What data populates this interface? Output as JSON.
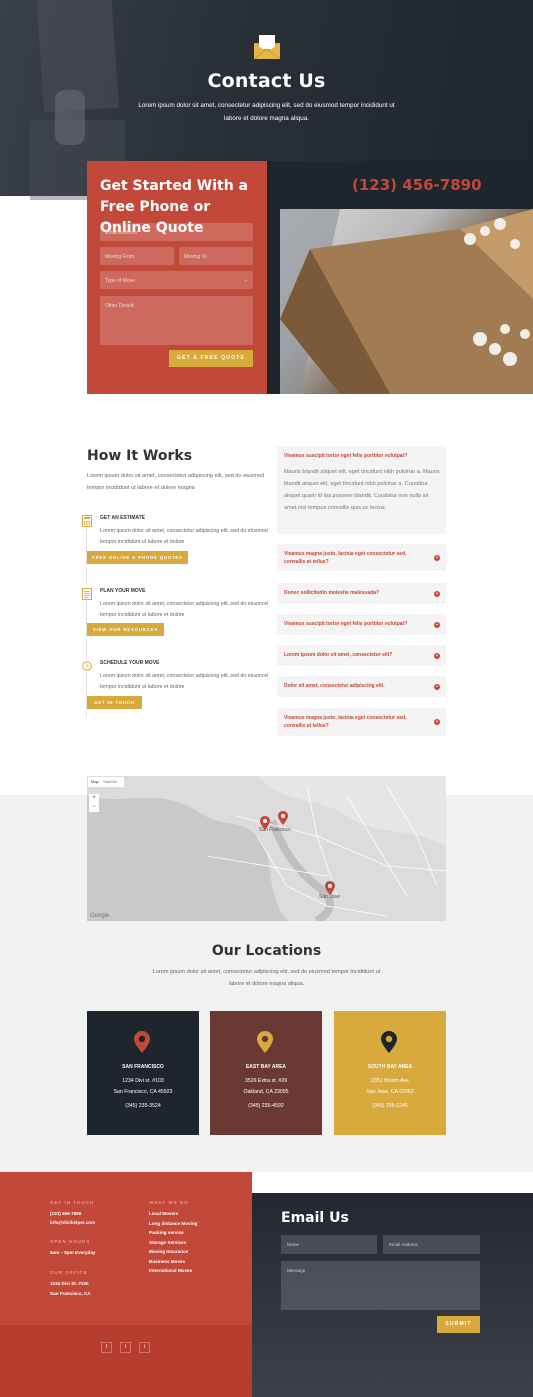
{
  "hero": {
    "title": "Contact Us",
    "text": "Lorem ipsum dolor sit amet, consectetur adipiscing elit, sed do eiusmod tempor incididunt ut labore et dolore magna aliqua."
  },
  "quote": {
    "title": "Get Started With a Free Phone or Online Quote",
    "email_placeholder": "Email Address",
    "moving_from_placeholder": "Moving From",
    "moving_to_placeholder": "Moving To",
    "type_of_move_placeholder": "Type of Move",
    "details_placeholder": "Other Details",
    "button": "GET A FREE QUOTE"
  },
  "phone": "(123) 456-7890",
  "how": {
    "title": "How It Works",
    "text": "Lorem ipsum dolor sit amet, consectetur adipiscing elit, sed do eiusmod tempor incididunt ut labore et dolore magna",
    "steps": [
      {
        "title": "GET AN ESTIMATE",
        "text": "Lorem ipsum dolor sit amet, consectetur adipiscing elit, sed do eiusmod tempor incididunt ut labore et dolore",
        "button": "FREE ONLINE & PHONE QUOTES",
        "icon": "calculator-icon"
      },
      {
        "title": "PLAN YOUR MOVE",
        "text": "Lorem ipsum dolor sit amet, consectetur adipiscing elit, sed do eiusmod tempor incididunt ut labore et dolore",
        "button": "VIEW OUR RESOURCES",
        "icon": "document-icon"
      },
      {
        "title": "SCHEDULE YOUR MOVE",
        "text": "Lorem ipsum dolor sit amet, consectetur adipiscing elit, sed do eiusmod tempor incididunt ut labore et dolore",
        "button": "GET IN TOUCH",
        "icon": "clock-icon"
      }
    ]
  },
  "faq": {
    "open_title": "Vivamus suscipit tortor eget felis porttitor volutpat?",
    "open_body": "Mauris blandit aliquet elit, eget tincidunt nibh pulvinar a. Mauris blandit aliquet elit, eget tincidunt nibh pulvinar a. Curabitur aliquet quam id dui posuere blandit. Curabitur non nulla sit amet nisl tempus convallis quis ac lectus.",
    "items": [
      "Vivamus magna justo, lacinia eget consectetur sed, convallis at tellus?",
      "Donec sollicitudin molestie malesuada?",
      "Vivamus suscipit tortor eget felis porttitor volutpat?",
      "Lorem ipsum dolor sit amet, consectetur elit?",
      "Dolor sit amet, consectetur adipiscing elit.",
      "Vivamus magna justo, lacinia eget consectetur sed, convallis at tellus?"
    ]
  },
  "map": {
    "tab_map": "Map",
    "tab_satellite": "Satellite",
    "zoom_in": "+",
    "zoom_out": "−",
    "label_sf": "San Francisco",
    "label_sj": "San Jose",
    "logo": "Google"
  },
  "locations": {
    "title": "Our Locations",
    "text": "Lorem ipsum dolor sit amet, consectetur adipiscing elit, sed do eiusmod tempor incididunt ut labore et dolore magna aliqua.",
    "cards": [
      {
        "city": "SAN FRANCISCO",
        "line1": "1234 Divi st. #103",
        "line2": "San Francisco, CA 45923",
        "phone": "(345) 235-3524",
        "color": "#1f252d",
        "pin": "#c2483a"
      },
      {
        "city": "EAST BAY AREA",
        "line1": "3526 Extra st. #29",
        "line2": "Oakland, CA 23095",
        "phone": "(345) 235-4592",
        "color": "#6b3933",
        "pin": "#d8a93c"
      },
      {
        "city": "SOUTH BAY AREA",
        "line1": "2351 Bloom Ave",
        "line2": "San Jose, CA 62962",
        "phone": "(345) 235-1245",
        "color": "#d8a93c",
        "pin": "#1f252d"
      }
    ]
  },
  "footer": {
    "touch_heading": "GET IN TOUCH",
    "touch_phone": "(123) 456-7890",
    "touch_email": "info@divihelper.com",
    "hours_heading": "OPEN HOURS",
    "hours": "6am – 5pm Everyday",
    "office_heading": "OUR OFFICE",
    "office_line1": "1234 Divi St. #100",
    "office_line2": "San Francisco, CA",
    "services_heading": "WHAT WE DO",
    "services": [
      "Local Movers",
      "Long distance Moving",
      "Packing service",
      "Storage Services",
      "Moving Insurance",
      "Business Moves",
      "International Moves"
    ],
    "social": [
      "f",
      "t",
      "i"
    ]
  },
  "email_form": {
    "title": "Email Us",
    "name_placeholder": "Name",
    "email_placeholder": "Email Address",
    "message_placeholder": "Message",
    "button": "SUBMIT"
  },
  "colors": {
    "red": "#c2483a",
    "gold": "#d8a93c",
    "dark": "#1f252d",
    "brown": "#6b3933"
  }
}
